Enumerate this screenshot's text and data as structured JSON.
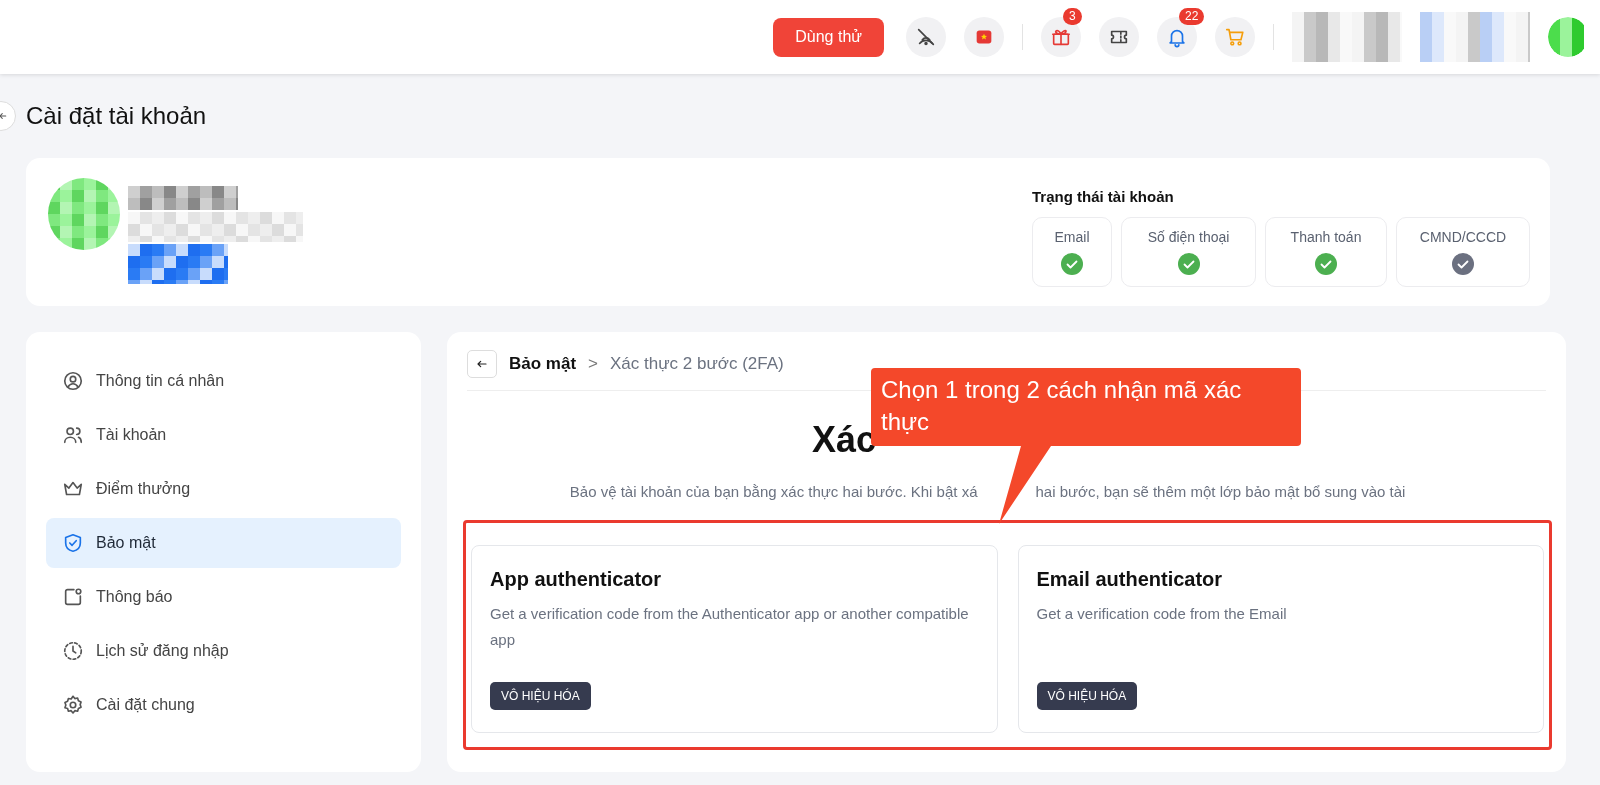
{
  "header": {
    "trial_button": "Dùng thử",
    "icons": [
      {
        "kind": "no-signal"
      },
      {
        "kind": "flag"
      },
      {
        "kind": "divider"
      },
      {
        "kind": "gift",
        "badge": "3"
      },
      {
        "kind": "ticket"
      },
      {
        "kind": "bell",
        "badge": "22"
      },
      {
        "kind": "cart"
      }
    ]
  },
  "page_title": "Cài đặt tài khoản",
  "account_status": {
    "title": "Trạng thái tài khoản",
    "items": [
      {
        "label": "Email",
        "verified": true
      },
      {
        "label": "Số điện thoại",
        "verified": true
      },
      {
        "label": "Thanh toán",
        "verified": true
      },
      {
        "label": "CMND/CCCD",
        "verified": false
      }
    ]
  },
  "sidebar": {
    "items": [
      {
        "label": "Thông tin cá nhân",
        "selected": false
      },
      {
        "label": "Tài khoản",
        "selected": false
      },
      {
        "label": "Điểm thưởng",
        "selected": false
      },
      {
        "label": "Bảo mật",
        "selected": true
      },
      {
        "label": "Thông báo",
        "selected": false
      },
      {
        "label": "Lịch sử đăng nhập",
        "selected": false
      },
      {
        "label": "Cài đặt chung",
        "selected": false
      }
    ]
  },
  "breadcrumb": {
    "parent": "Bảo mật",
    "separator": ">",
    "current": "Xác thực 2 bước (2FA)"
  },
  "heading": "Xác",
  "description": [
    "Bảo vệ tài khoản của bạn bằng xác thực hai bước. Khi bật xá",
    "hai bước, bạn sẽ thêm một lớp bảo mật bổ sung vào tài"
  ],
  "methods": [
    {
      "title": "App authenticator",
      "text": "Get a verification code from the Authenticator app or another compatible app",
      "button": "VÔ HIỆU HÓA"
    },
    {
      "title": "Email authenticator",
      "text": "Get a verification code from the Email",
      "button": "VÔ HIỆU HÓA"
    }
  ],
  "callout": "Chọn 1 trong 2 cách nhận mã xác thực"
}
